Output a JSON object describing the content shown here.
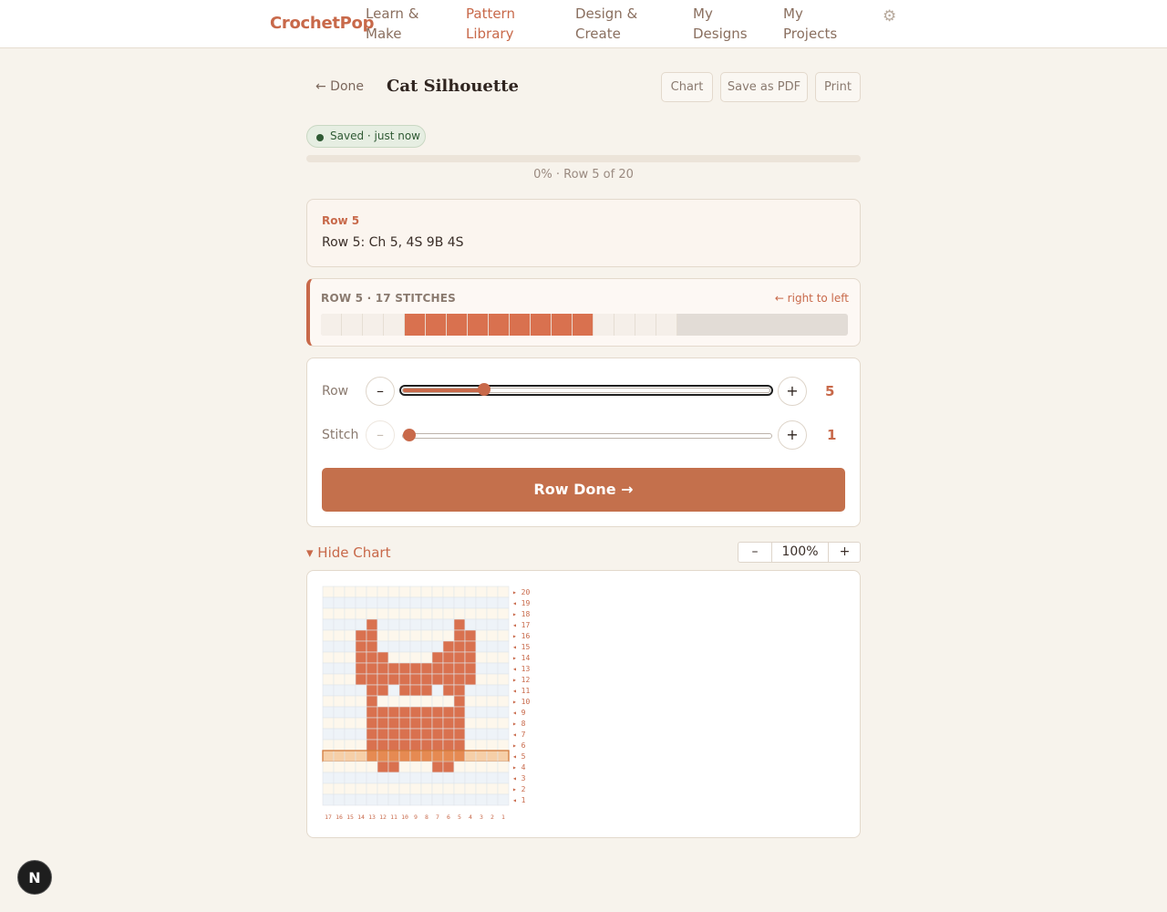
{
  "nav": {
    "brand": "CrochetPop",
    "items": [
      {
        "label": "Learn & Make",
        "active": false
      },
      {
        "label": "Pattern Library",
        "active": true
      },
      {
        "label": "Design & Create",
        "active": false
      },
      {
        "label": "My Designs",
        "active": false
      },
      {
        "label": "My Projects",
        "active": false
      }
    ],
    "settings_icon": "gear-icon"
  },
  "header": {
    "done_label": "← Done",
    "title": "Cat Silhouette",
    "actions": {
      "chart": "Chart",
      "save_pdf": "Save as PDF",
      "print": "Print"
    }
  },
  "status": {
    "saved_label": "Saved · just now",
    "progress_fraction": 0.0,
    "progress_text": "0% · Row 5 of 20"
  },
  "instruction": {
    "label": "Row 5",
    "text": "Row 5: Ch 5, 4S 9B 4S"
  },
  "current_row": {
    "title": "ROW 5 · 17 STITCHES",
    "direction": "← right to left",
    "stitches": "SSSSBBBBBBBBBSSSS"
  },
  "controls": {
    "row_label": "Row",
    "row_value": "5",
    "row_min": 1,
    "row_max": 20,
    "stitch_label": "Stitch",
    "stitch_value": "1",
    "stitch_min": 1,
    "stitch_max": 17,
    "minus": "–",
    "plus": "+",
    "row_done": "Row Done →"
  },
  "chart_toggle": {
    "label": "▾ Hide Chart"
  },
  "zoom": {
    "minus": "–",
    "level": "100%",
    "plus": "+"
  },
  "colors": {
    "accent": "#c8694a",
    "stitch_b": "#d9714f",
    "highlight": "#f6cfa8",
    "grid_odd": "#eef3f8",
    "grid_even": "#fdf7ec"
  },
  "pattern_grid": {
    "current_row": 5,
    "rows": [
      {
        "row": 20,
        "dir": "▸",
        "cells": "SSSSSSSSSSSSSSSSS"
      },
      {
        "row": 19,
        "dir": "◂",
        "cells": "SSSSSSSSSSSSSSSSS"
      },
      {
        "row": 18,
        "dir": "▸",
        "cells": "SSSSSSSSSSSSSSSSS"
      },
      {
        "row": 17,
        "dir": "◂",
        "cells": "SSSSBSSSSSSSBSSSS"
      },
      {
        "row": 16,
        "dir": "▸",
        "cells": "SSSBBSSSSSSSBBSSS"
      },
      {
        "row": 15,
        "dir": "◂",
        "cells": "SSSBBSSSSSSBBBSSS"
      },
      {
        "row": 14,
        "dir": "▸",
        "cells": "SSSBBBSSSSBBBBSSS"
      },
      {
        "row": 13,
        "dir": "◂",
        "cells": "SSSBBBBBBBBBBBSSS"
      },
      {
        "row": 12,
        "dir": "▸",
        "cells": "SSSBBBBBBBBBBBSSS"
      },
      {
        "row": 11,
        "dir": "◂",
        "cells": "SSSSBBSBBBSBBSSSS"
      },
      {
        "row": 10,
        "dir": "▸",
        "cells": "SSSSBSSSSSSSBSSSS"
      },
      {
        "row": 9,
        "dir": "◂",
        "cells": "SSSSBBBBBBBBBSSSS"
      },
      {
        "row": 8,
        "dir": "▸",
        "cells": "SSSSBBBBBBBBBSSSS"
      },
      {
        "row": 7,
        "dir": "◂",
        "cells": "SSSSBBBBBBBBBSSSS"
      },
      {
        "row": 6,
        "dir": "▸",
        "cells": "SSSSBBBBBBBBBSSSS"
      },
      {
        "row": 5,
        "dir": "◂",
        "cells": "SSSSBBBBBBBBBSSSS"
      },
      {
        "row": 4,
        "dir": "▸",
        "cells": "SSSSSBBSSSBBSSSSS"
      },
      {
        "row": 3,
        "dir": "◂",
        "cells": "SSSSSSSSSSSSSSSSS"
      },
      {
        "row": 2,
        "dir": "▸",
        "cells": "SSSSSSSSSSSSSSSSS"
      },
      {
        "row": 1,
        "dir": "◂",
        "cells": "SSSSSSSSSSSSSSSSS"
      }
    ],
    "column_labels": [
      "17",
      "16",
      "15",
      "14",
      "13",
      "12",
      "11",
      "10",
      "9",
      "8",
      "7",
      "6",
      "5",
      "4",
      "3",
      "2",
      "1"
    ]
  },
  "badge": {
    "label": "N"
  }
}
